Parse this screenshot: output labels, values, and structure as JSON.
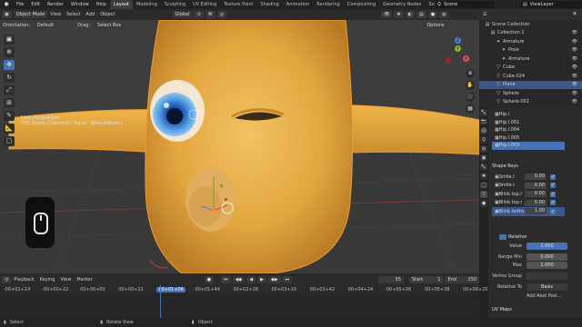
{
  "topbar": {
    "menus": [
      "File",
      "Edit",
      "Render",
      "Window",
      "Help"
    ],
    "workspaces": [
      "Layout",
      "Modeling",
      "Sculpting",
      "UV Editing",
      "Texture Paint",
      "Shading",
      "Animation",
      "Rendering",
      "Compositing",
      "Geometry Nodes",
      "Scripting"
    ],
    "active_workspace": "Layout",
    "scene": "Scene",
    "view_layer": "ViewLayer"
  },
  "viewport_header": {
    "mode": "Object Mode",
    "menus": [
      "View",
      "Select",
      "Add",
      "Object"
    ],
    "transform": "Global",
    "orientation_label": "Orientation:",
    "orientation_value": "Default",
    "drag_label": "Drag:",
    "drag_value": "Select Box",
    "options": "Options"
  },
  "viewport": {
    "overlay_line1": "User Perspective",
    "overlay_line2": "(55) Scene Collection | Plane : Blink.bottom.l",
    "accent": "#4772b3",
    "background": "#3d3d3d"
  },
  "toolbar": {
    "tools": [
      "select-icon",
      "cursor-icon",
      "move-icon",
      "rotate-icon",
      "scale-icon",
      "transform-icon",
      "annotate-icon",
      "measure-icon",
      "add-cube-icon"
    ],
    "glyphs": [
      "▣",
      "⊕",
      "✥",
      "↻",
      "⤢",
      "⊞",
      "✎",
      "📐",
      "▢"
    ],
    "active_index": 2
  },
  "gizmo": {
    "x": "X",
    "y": "Y",
    "z": "Z"
  },
  "outliner": {
    "title": "Scene Collection",
    "rows": [
      {
        "name": "Collection 1",
        "icon": "▤",
        "indent": 1
      },
      {
        "name": "Armature",
        "icon": "✦",
        "indent": 2
      },
      {
        "name": "Pose",
        "icon": "✦",
        "indent": 3
      },
      {
        "name": "Armature",
        "icon": "✦",
        "indent": 3
      },
      {
        "name": "Cube",
        "icon": "▽",
        "indent": 2
      },
      {
        "name": "Cube.024",
        "icon": "▽",
        "indent": 2
      },
      {
        "name": "Plane",
        "icon": "▽",
        "indent": 2,
        "selected": true
      },
      {
        "name": "Sphere",
        "icon": "▽",
        "indent": 2
      },
      {
        "name": "Sphere.002",
        "icon": "▽",
        "indent": 2
      }
    ]
  },
  "properties": {
    "vertex_groups": [
      "Hip.l",
      "Hip.l.001",
      "Hip.l.004",
      "Hip.l.005",
      "Hip.l.003"
    ],
    "shape_keys_title": "Shape Keys",
    "shape_keys": [
      {
        "name": "Smile.l",
        "value": "0.00"
      },
      {
        "name": "Smile.r",
        "value": "0.00"
      },
      {
        "name": "Blink.top.l",
        "value": "0.00"
      },
      {
        "name": "Blink.top.r",
        "value": "0.00"
      },
      {
        "name": "Blink.botto...",
        "value": "1.00",
        "selected": true
      }
    ],
    "relative_label": "Relative",
    "value_label": "Value",
    "value": "1.000",
    "range_min_label": "Range Min",
    "range_min": "0.000",
    "max_label": "Max",
    "max": "1.000",
    "vertex_group_label": "Vertex Group",
    "relative_to_label": "Relative To",
    "relative_to": "Basis",
    "add_rest": "Add Rest Posi...",
    "uv_maps": "UV Maps"
  },
  "timeline": {
    "menus": [
      "Playback",
      "Keying",
      "View",
      "Marker"
    ],
    "current_frame": "55",
    "start_label": "Start",
    "start": "1",
    "end_label": "End",
    "end": "250",
    "ticks": [
      "-00+01+14",
      "-00+00+22",
      "00+00+00",
      "00+00+22",
      "00+01+06",
      "00+01+44",
      "00+02+28",
      "00+03+10",
      "00+03+42",
      "00+04+24",
      "00+05+06",
      "00+05+38",
      "00+06+20"
    ],
    "current_time": "00+01+06"
  },
  "statusbar": {
    "left": "Select",
    "middle": "Rotate View",
    "right": "Object"
  }
}
